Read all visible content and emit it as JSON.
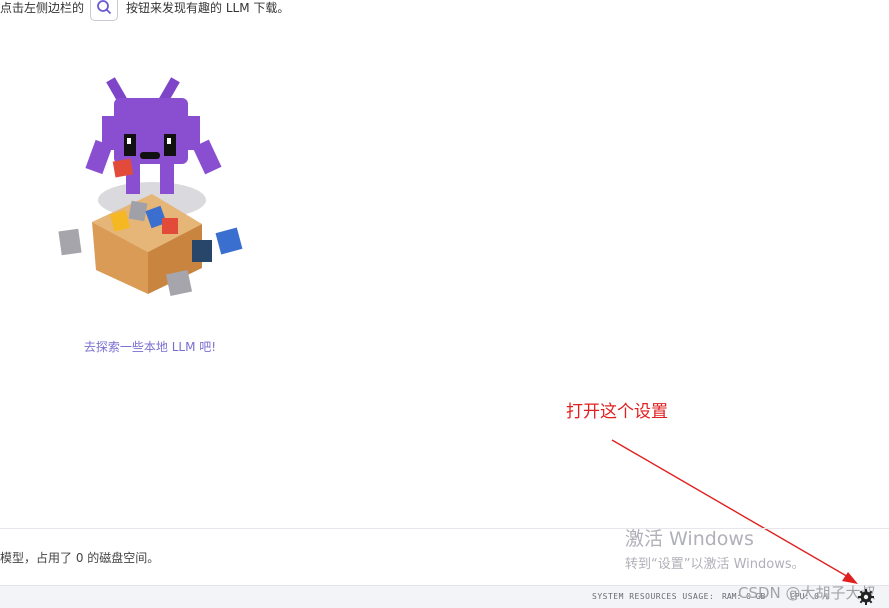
{
  "hint": {
    "before": "点击左侧边栏的",
    "after": "按钮来发现有趣的 LLM 下载。"
  },
  "explore_text": "去探索一些本地 LLM 吧!",
  "annotation": {
    "text": "打开这个设置",
    "color": "#e02020"
  },
  "disk_text": "模型，占用了 0 的磁盘空间。",
  "watermark": {
    "line1": "激活 Windows",
    "line2": "转到“设置”以激活 Windows。"
  },
  "status_bar": {
    "resources_label": "SYSTEM RESOURCES USAGE:",
    "ram": "RAM: 0 GB",
    "cpu": "CPU: 0 %"
  },
  "csdn_watermark": "CSDN @大胡子大叔",
  "icons": {
    "search": "search-icon",
    "settings": "gear-icon",
    "mascot": "mascot-illustration"
  },
  "colors": {
    "accent": "#7a6fd0",
    "mascot_purple": "#8a4fd0"
  }
}
